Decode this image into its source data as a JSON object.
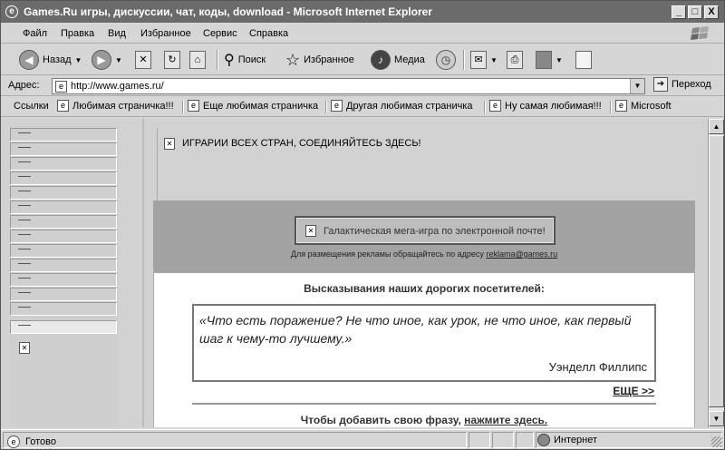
{
  "window": {
    "title": "Games.Ru игры, дискуссии, чат, коды, download - Microsoft Internet Explorer",
    "controls": [
      "_",
      "□",
      "X"
    ]
  },
  "menu": [
    "Файл",
    "Правка",
    "Вид",
    "Избранное",
    "Сервис",
    "Справка"
  ],
  "toolbar": {
    "back": "Назад",
    "search": "Поиск",
    "favorites": "Избранное",
    "media": "Медиа"
  },
  "address": {
    "label": "Адрес:",
    "value": "http://www.games.ru/",
    "go": "Переход"
  },
  "links": {
    "label": "Ссылки",
    "items": [
      "Любимая страничка!!!",
      "Еще любимая страничка",
      "Другая любимая страничка",
      "Ну самая любимая!!!",
      "Microsoft"
    ]
  },
  "page": {
    "top_banner_text": "ИГРАРИИ ВСЕХ СТРАН, СОЕДИНЯЙТЕСЬ ЗДЕСЬ!",
    "ad_button_text": "Галактическая мега-игра по электронной почте!",
    "ad_note_prefix": "Для размещения рекламы обращайтесь по адресу",
    "ad_email": "reklama@games.ru",
    "quotes_heading": "Высказывания наших дорогих посетителей:",
    "quote_text": "«Что есть поражение? Не что иное, как урок, не что иное, как первый шаг к чему-то лучшему.»",
    "quote_author": "Уэнделл Филлипс",
    "more_link": "ЕЩЕ >>",
    "add_phrase_prefix": "Чтобы добавить свою фразу,",
    "add_phrase_link": "нажмите здесь."
  },
  "status": {
    "text": "Готово",
    "zone": "Интернет"
  }
}
